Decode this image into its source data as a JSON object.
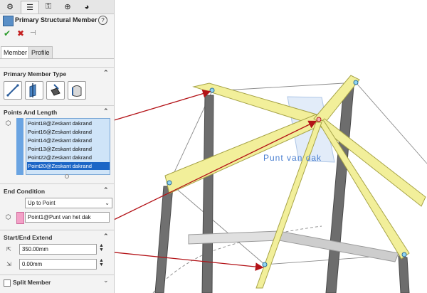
{
  "panel": {
    "tabs": [
      "featuremanager-icon",
      "propertymanager-icon",
      "configurationmanager-icon",
      "dimxpert-icon",
      "appearance-icon"
    ],
    "title": "Primary Structural Member",
    "help": "?",
    "ok_glyph": "✔",
    "cancel_glyph": "✖",
    "pin_glyph": "⊣",
    "subtabs": [
      "Member",
      "Profile"
    ],
    "primary_member_type": {
      "label": "Primary Member Type",
      "options": [
        "line-member-icon",
        "plane-member-icon",
        "point-length-icon",
        "between-points-icon"
      ]
    },
    "points_and_length": {
      "label": "Points And Length",
      "points": [
        "Point18@Zeskant dakrand",
        "Point16@Zeskant dakrand",
        "Point14@Zeskant dakrand",
        "Point13@Zeskant dakrand",
        "Point22@Zeskant dakrand",
        "Point20@Zeskant dakrand"
      ],
      "selected_index": 5
    },
    "end_condition": {
      "label": "End Condition",
      "type": "Up to Point",
      "reference": "Point1@Punt van het dak"
    },
    "start_end_extend": {
      "label": "Start/End Extend",
      "start": "350.00mm",
      "end": "0.00mm"
    },
    "split_member": {
      "label": "Split Member",
      "checked": false
    }
  },
  "viewport": {
    "annotation": "Punt van dak",
    "colors": {
      "member": "#f2ef9a",
      "member_edge": "#a7a448",
      "column": "#6e6e6e",
      "arrow": "#b31217",
      "annotation": "#4a7fd0",
      "plane": "#cfe0f6"
    }
  }
}
